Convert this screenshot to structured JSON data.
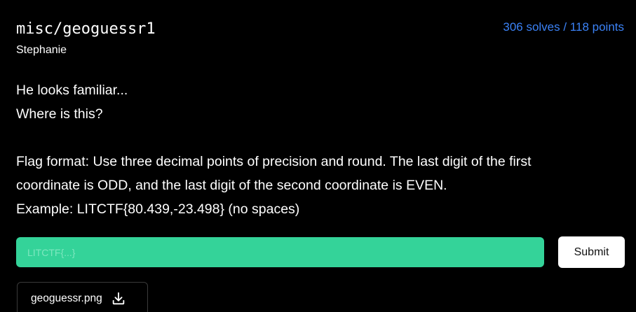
{
  "challenge": {
    "title": "misc/geoguessr1",
    "author": "Stephanie",
    "stats": "306 solves / 118 points",
    "description": {
      "line1": "He looks familiar...",
      "line2": "Where is this?",
      "line3": "Flag format: Use three decimal points of precision and round. The last digit of the first",
      "line4": "coordinate is ODD, and the last digit of the second coordinate is EVEN.",
      "line5": "Example: LITCTF{80.439,-23.498} (no spaces)"
    }
  },
  "form": {
    "flag_placeholder": "LITCTF{...}",
    "flag_value": "",
    "submit_label": "Submit"
  },
  "attachment": {
    "file_name": "geoguessr.png",
    "icon": "download-icon"
  },
  "colors": {
    "background": "#000000",
    "stats_accent": "#3b82f6",
    "input_bg": "#34d399",
    "button_bg": "#ffffff"
  }
}
